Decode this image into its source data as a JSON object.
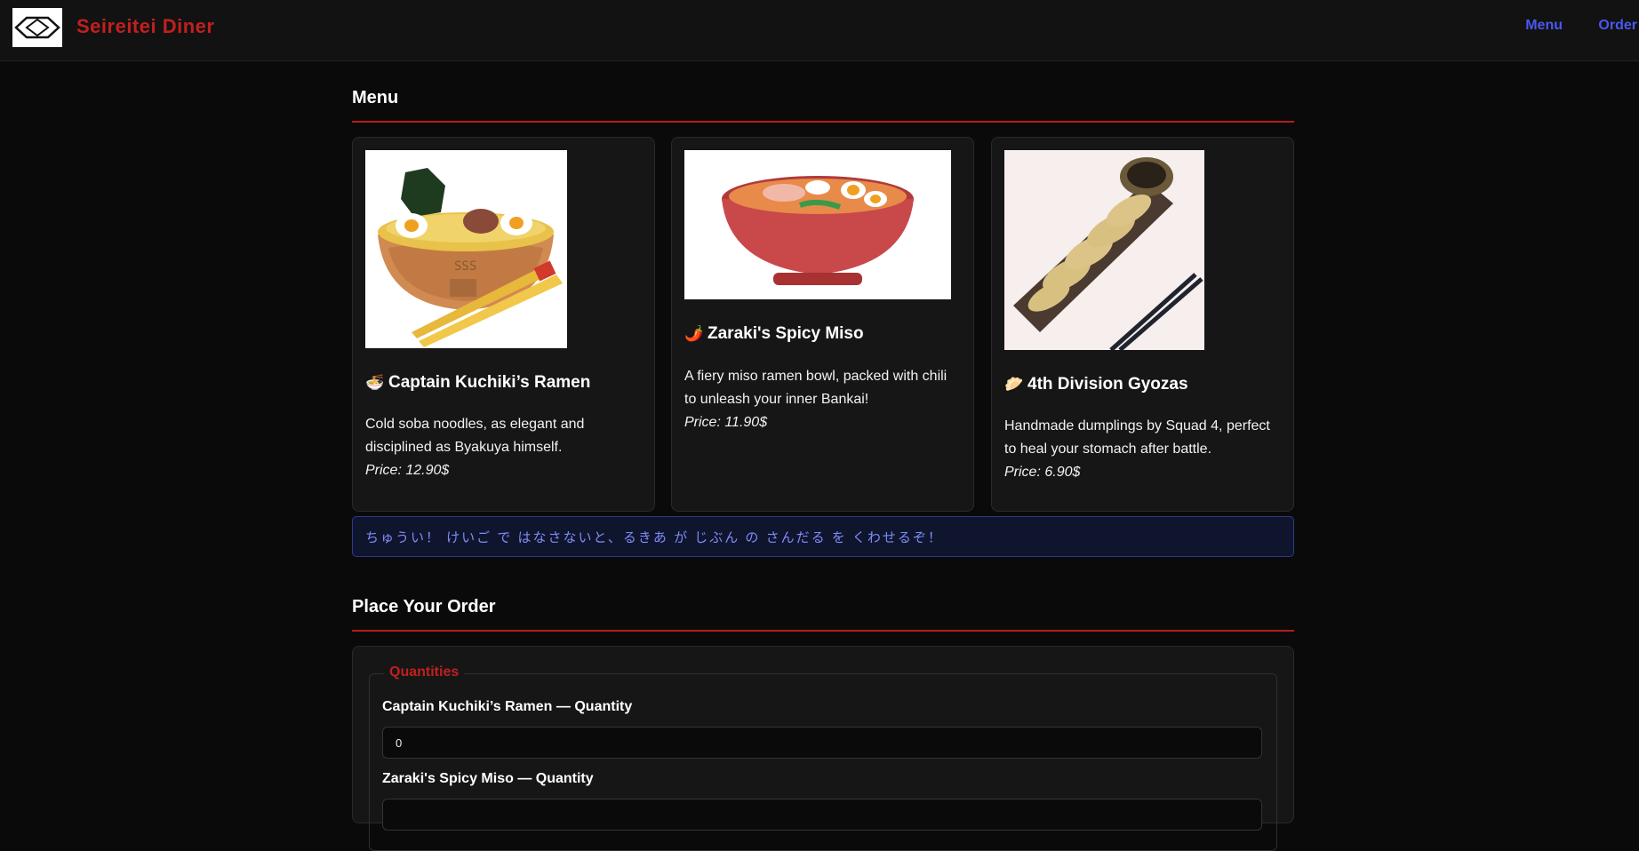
{
  "header": {
    "brand": "Seireitei Diner",
    "logo_icon": "squad-emblem-icon",
    "nav": [
      {
        "label": "Menu"
      },
      {
        "label": "Order"
      }
    ]
  },
  "menu": {
    "title": "Menu",
    "items": [
      {
        "emoji": "🍜",
        "name": "Captain Kuchiki’s Ramen",
        "description": "Cold soba noodles, as elegant and disciplined as Byakuya himself.",
        "price": "Price: 12.90$",
        "image_icon": "ramen-bowl-image"
      },
      {
        "emoji": "🌶️",
        "name": "Zaraki's Spicy Miso",
        "description": "A fiery miso ramen bowl, packed with chili to unleash your inner Bankai!",
        "price": "Price: 11.90$",
        "image_icon": "miso-ramen-image"
      },
      {
        "emoji": "🥟",
        "name": "4th Division Gyozas",
        "description": "Handmade dumplings by Squad 4, perfect to heal your stomach after battle.",
        "price": "Price: 6.90$",
        "image_icon": "gyoza-plate-image"
      }
    ],
    "notice": "ちゅうい！ けいご で はなさないと、るきあ が じぶん の さんだる を くわせるぞ！"
  },
  "order": {
    "title": "Place Your Order",
    "legend": "Quantities",
    "fields": [
      {
        "label": "Captain Kuchiki’s Ramen — Quantity",
        "value": "0"
      },
      {
        "label": "Zaraki's Spicy Miso — Quantity",
        "value": ""
      }
    ]
  },
  "colors": {
    "accent_red": "#c0201f",
    "link_blue": "#4a58f0",
    "notice_text": "#7f8cf6"
  }
}
